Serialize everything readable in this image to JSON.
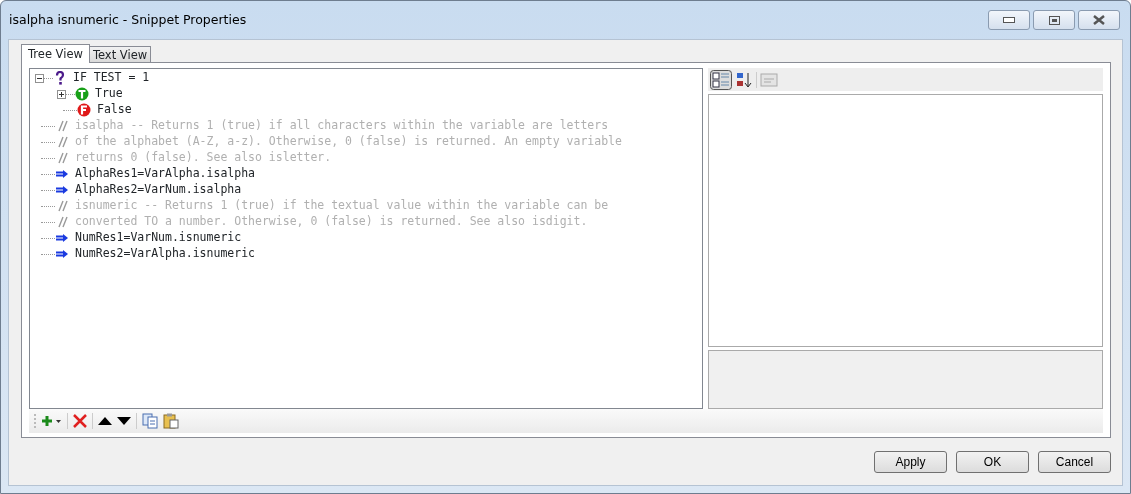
{
  "window": {
    "title": "isalpha isnumeric - Snippet Properties"
  },
  "tabs": [
    {
      "label": "Tree View",
      "selected": true
    },
    {
      "label": "Text View",
      "selected": false
    }
  ],
  "tree": [
    {
      "kind": "condition",
      "text": "IF TEST = 1",
      "expanded": true,
      "children": [
        {
          "kind": "true",
          "text": "True",
          "expanded": false
        },
        {
          "kind": "false",
          "text": "False"
        }
      ]
    },
    {
      "kind": "comment",
      "text": "isalpha -- Returns 1 (true) if all characters within the variable are letters"
    },
    {
      "kind": "comment",
      "text": "of the alphabet (A-Z, a-z). Otherwise, 0 (false) is returned. An empty variable"
    },
    {
      "kind": "comment",
      "text": "returns 0 (false). See also isletter."
    },
    {
      "kind": "assign",
      "text": "AlphaRes1=VarAlpha.isalpha"
    },
    {
      "kind": "assign",
      "text": "AlphaRes2=VarNum.isalpha"
    },
    {
      "kind": "comment",
      "text": "isnumeric -- Returns 1 (true) if the textual value within the variable can be"
    },
    {
      "kind": "comment",
      "text": "converted TO a number. Otherwise, 0 (false) is returned. See also isdigit."
    },
    {
      "kind": "assign",
      "text": "NumRes1=VarNum.isnumeric"
    },
    {
      "kind": "assign",
      "text": "NumRes2=VarAlpha.isnumeric"
    }
  ],
  "buttons": [
    "Apply",
    "OK",
    "Cancel"
  ]
}
